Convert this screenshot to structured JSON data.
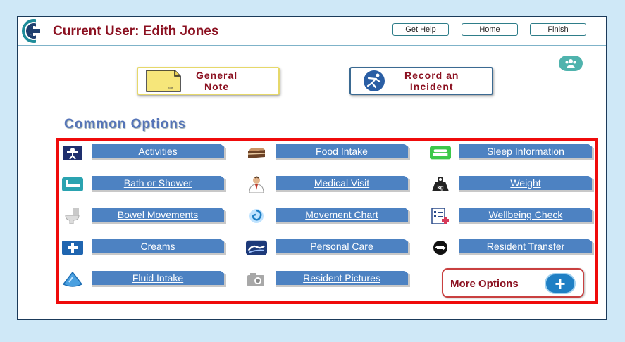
{
  "header": {
    "current_user": "Current User: Edith Jones",
    "buttons": [
      {
        "label": "Get Help"
      },
      {
        "label": "Home"
      },
      {
        "label": "Finish"
      }
    ]
  },
  "quick_actions": {
    "general_note": "General\nNote",
    "record_incident": "Record an\nIncident"
  },
  "common_options": {
    "title": "Common Options",
    "columns": [
      [
        {
          "label": "Activities",
          "icon": "activities-icon"
        },
        {
          "label": "Bath or Shower",
          "icon": "bath-icon"
        },
        {
          "label": "Bowel Movements",
          "icon": "toilet-icon"
        },
        {
          "label": "Creams",
          "icon": "first-aid-icon"
        },
        {
          "label": "Fluid Intake",
          "icon": "water-drop-icon"
        }
      ],
      [
        {
          "label": "Food Intake",
          "icon": "cake-icon"
        },
        {
          "label": "Medical Visit",
          "icon": "doctor-icon"
        },
        {
          "label": "Movement Chart",
          "icon": "swirl-icon"
        },
        {
          "label": "Personal Care",
          "icon": "hands-icon"
        },
        {
          "label": "Resident Pictures",
          "icon": "camera-icon"
        }
      ],
      [
        {
          "label": "Sleep Information",
          "icon": "bed-icon"
        },
        {
          "label": "Weight",
          "icon": "kg-weight-icon"
        },
        {
          "label": "Wellbeing Check",
          "icon": "checklist-icon"
        },
        {
          "label": "Resident Transfer",
          "icon": "transfer-arrows-icon"
        }
      ]
    ],
    "more_options": "More Options"
  },
  "colors": {
    "title_red": "#8b1020",
    "option_blue": "#4d82c2",
    "highlight_red": "#ef0b0b",
    "teal": "#4fb3ad"
  }
}
